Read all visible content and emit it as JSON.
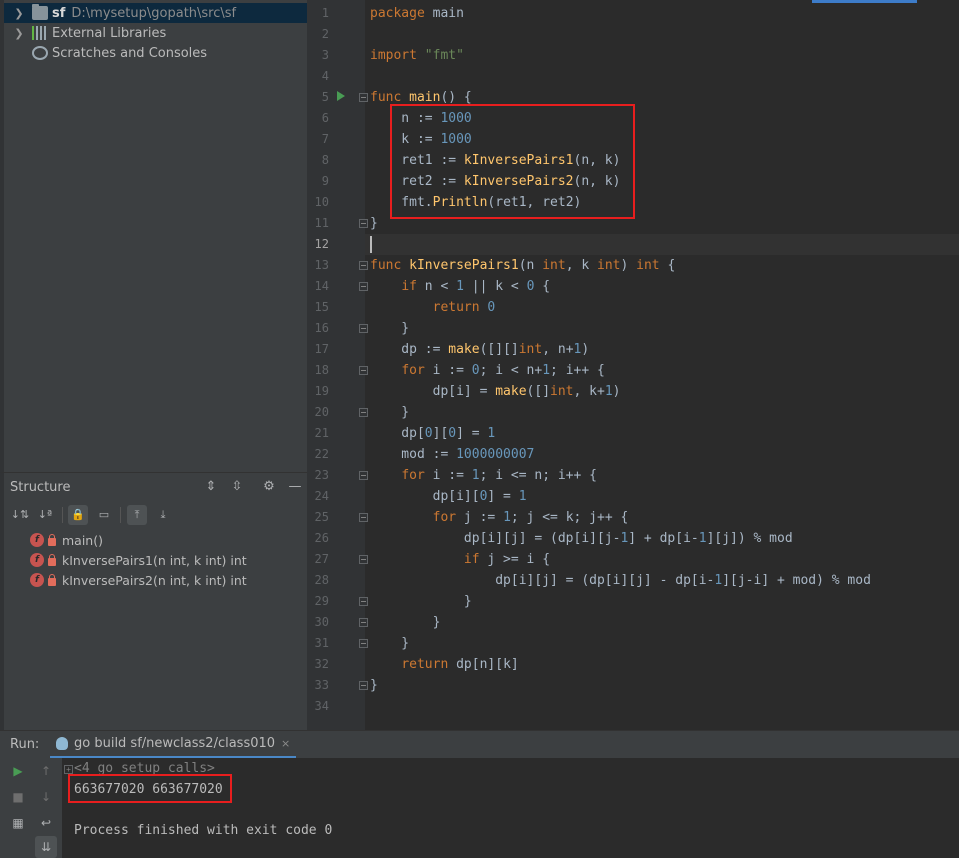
{
  "project": {
    "items": [
      {
        "name": "sf",
        "path": "D:\\mysetup\\gopath\\src\\sf"
      },
      {
        "name": "External Libraries"
      },
      {
        "name": "Scratches and Consoles"
      }
    ]
  },
  "structure": {
    "title": "Structure",
    "items": [
      {
        "badge": "f",
        "label": "main()"
      },
      {
        "badge": "f",
        "label": "kInversePairs1(n int, k int) int"
      },
      {
        "badge": "f",
        "label": "kInversePairs2(n int, k int) int"
      }
    ]
  },
  "editor": {
    "line_numbers": [
      "1",
      "2",
      "3",
      "4",
      "5",
      "6",
      "7",
      "8",
      "9",
      "10",
      "11",
      "12",
      "13",
      "14",
      "15",
      "16",
      "17",
      "18",
      "19",
      "20",
      "21",
      "22",
      "23",
      "24",
      "25",
      "26",
      "27",
      "28",
      "29",
      "30",
      "31",
      "32",
      "33",
      "34"
    ],
    "current_line": "12",
    "lines": [
      "package main",
      "",
      "import \"fmt\"",
      "",
      "func main() {",
      "    n := 1000",
      "    k := 1000",
      "    ret1 := kInversePairs1(n, k)",
      "    ret2 := kInversePairs2(n, k)",
      "    fmt.Println(ret1, ret2)",
      "}",
      "",
      "func kInversePairs1(n int, k int) int {",
      "    if n < 1 || k < 0 {",
      "        return 0",
      "    }",
      "    dp := make([][]int, n+1)",
      "    for i := 0; i < n+1; i++ {",
      "        dp[i] = make([]int, k+1)",
      "    }",
      "    dp[0][0] = 1",
      "    mod := 1000000007",
      "    for i := 1; i <= n; i++ {",
      "        dp[i][0] = 1",
      "        for j := 1; j <= k; j++ {",
      "            dp[i][j] = (dp[i][j-1] + dp[i-1][j]) % mod",
      "            if j >= i {",
      "                dp[i][j] = (dp[i][j] - dp[i-1][j-i] + mod) % mod",
      "            }",
      "        }",
      "    }",
      "    return dp[n][k]",
      "}"
    ]
  },
  "run": {
    "label": "Run:",
    "tab_label": "go build sf/newclass2/class010",
    "tab_close": "×",
    "console": {
      "setup_calls": "<4 go setup calls>",
      "output": "663677020 663677020",
      "finished": "Process finished with exit code 0"
    }
  },
  "colors": {
    "background": "#2b2b2b",
    "panel": "#3c3f41",
    "keyword": "#cc7832",
    "number": "#6897bb",
    "string": "#6a8759",
    "function": "#ffc66d",
    "highlight_box": "#e81e1e"
  }
}
